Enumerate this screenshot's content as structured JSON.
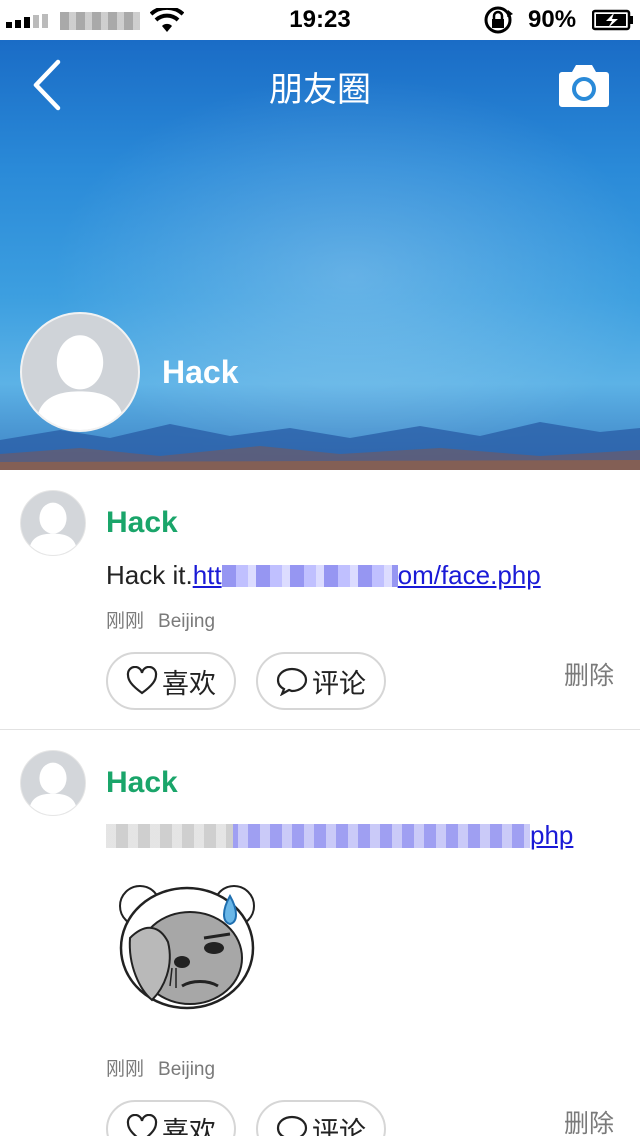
{
  "status_bar": {
    "time": "19:23",
    "battery_percent": "90%"
  },
  "cover": {
    "nav_title": "朋友圈",
    "user_name": "Hack"
  },
  "posts": [
    {
      "author": "Hack",
      "text_prefix": "Hack it.",
      "link_start": "htt",
      "link_end": "om/face.php",
      "time": "刚刚",
      "location": "Beijing",
      "like_label": "喜欢",
      "comment_label": "评论",
      "delete_label": "删除"
    },
    {
      "author": "Hack",
      "link_end": "php",
      "time": "刚刚",
      "location": "Beijing",
      "like_label": "喜欢",
      "comment_label": "评论",
      "delete_label": "删除"
    }
  ],
  "colors": {
    "author_green": "#1aa56a",
    "link_blue": "#1a1ad6",
    "meta_gray": "#7a7a7a"
  },
  "icons": [
    "back-icon",
    "camera-icon",
    "heart-icon",
    "comment-bubble-icon",
    "avatar-placeholder-icon",
    "wifi-icon",
    "battery-icon",
    "rotation-lock-icon"
  ]
}
